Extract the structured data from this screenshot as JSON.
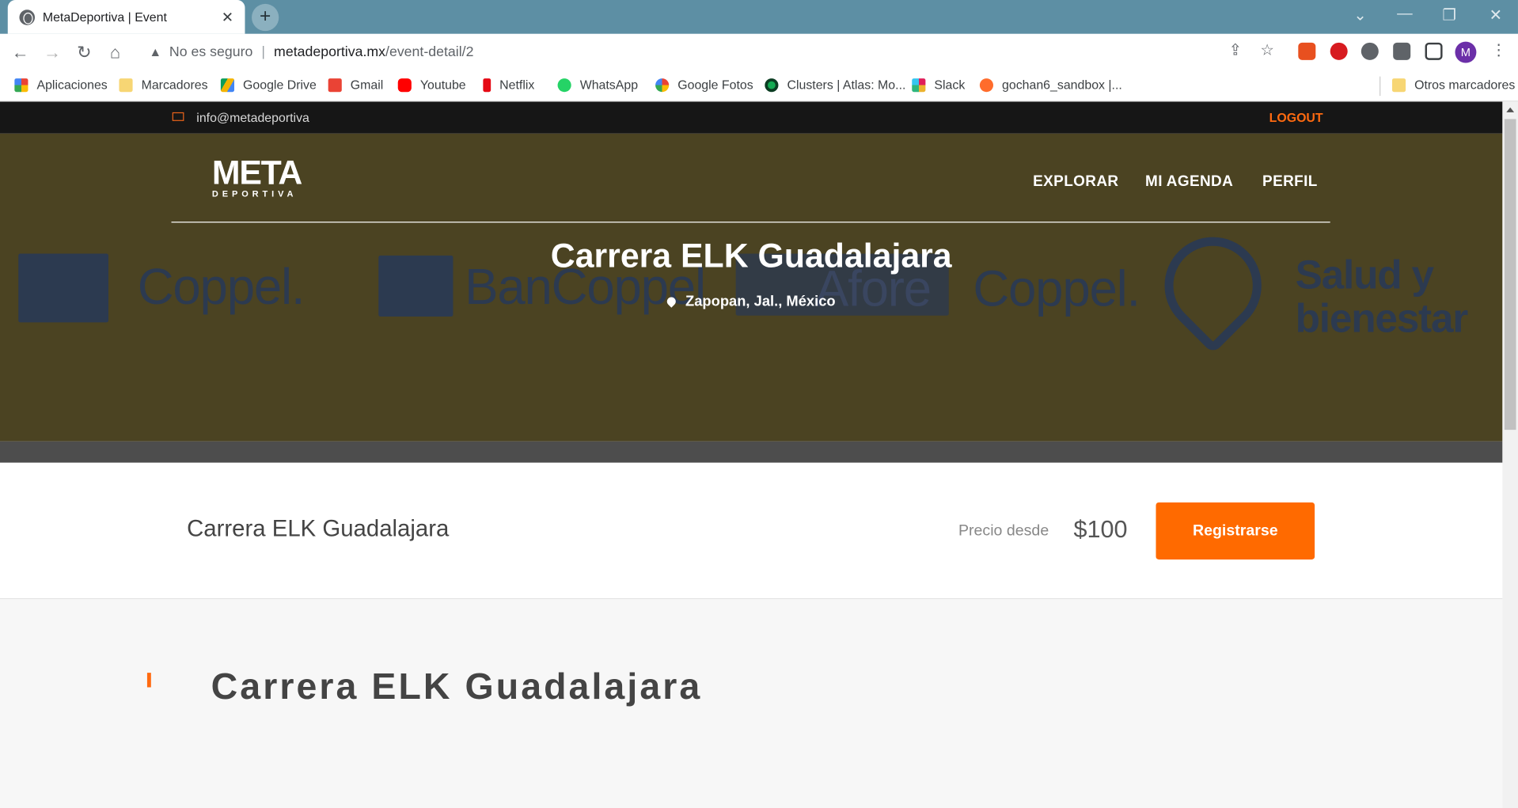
{
  "browser": {
    "tab_title": "MetaDeportiva | Event",
    "tab_close": "✕",
    "new_tab": "+",
    "security_label": "No es seguro",
    "url_host": "metadeportiva.mx",
    "url_path": "/event-detail/2",
    "avatar_letter": "M",
    "bookmarks": [
      "Aplicaciones",
      "Marcadores",
      "Google Drive",
      "Gmail",
      "Youtube",
      "Netflix",
      "WhatsApp",
      "Google Fotos",
      "Clusters | Atlas: Mo...",
      "Slack",
      "gochan6_sandbox |...",
      "Otros marcadores"
    ],
    "bookmark_icons": [
      "apps-grid-icon",
      "folder-icon",
      "google-drive-icon",
      "gmail-icon",
      "youtube-icon",
      "netflix-icon",
      "whatsapp-icon",
      "google-photos-icon",
      "mongodb-icon",
      "slack-icon",
      "cpanel-icon",
      "folder-icon"
    ]
  },
  "site": {
    "email": "info@metadeportiva",
    "logout": "LOGOUT",
    "logo_main": "META",
    "logo_sub": "DEPORTIVA",
    "nav": [
      "EXPLORAR",
      "MI AGENDA",
      "PERFIL"
    ],
    "accent_color": "#ff6a00"
  },
  "hero": {
    "title": "Carrera ELK Guadalajara",
    "location": "Zapopan, Jal., México",
    "sponsors": [
      "Coppel.",
      "BanCoppel",
      "Afore",
      "Coppel.",
      "Salud y",
      "bienestar"
    ]
  },
  "event": {
    "name": "Carrera ELK Guadalajara",
    "price_label": "Precio desde",
    "price": "$100",
    "register_label": "Registrarse"
  },
  "content": {
    "heading": "Carrera ELK Guadalajara"
  }
}
